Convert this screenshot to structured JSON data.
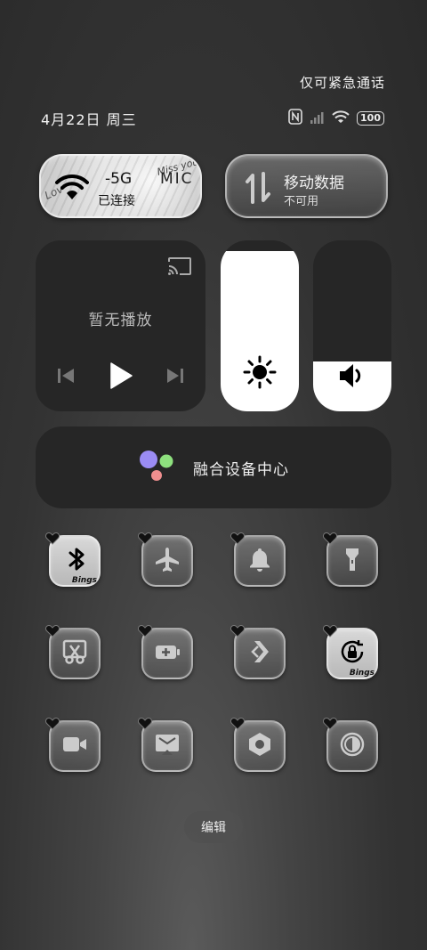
{
  "status": {
    "emergency": "仅可紧急通话",
    "date": "4月22日 周三",
    "battery": "100"
  },
  "wifi": {
    "ssid": "-5G",
    "extra": "MIC",
    "state": "已连接",
    "deco_left": "Lov",
    "deco_right": "Miss you"
  },
  "mobile_data": {
    "title": "移动数据",
    "state": "不可用"
  },
  "media": {
    "empty_label": "暂无播放"
  },
  "brightness": {
    "level_percent": 94
  },
  "volume": {
    "level_percent": 29
  },
  "fusion": {
    "label": "融合设备中心",
    "dot_colors": [
      "#9b8cf4",
      "#8ee07e",
      "#f08f8f"
    ]
  },
  "toggles": [
    {
      "name": "bluetooth",
      "icon": "bluetooth-icon",
      "active": true,
      "tag": "Bings"
    },
    {
      "name": "airplane",
      "icon": "airplane-icon",
      "active": false
    },
    {
      "name": "ring",
      "icon": "bell-icon",
      "active": false
    },
    {
      "name": "flashlight",
      "icon": "flashlight-icon",
      "active": false
    },
    {
      "name": "screenshot",
      "icon": "scissors-icon",
      "active": false
    },
    {
      "name": "battery-saver",
      "icon": "battery-plus-icon",
      "active": false
    },
    {
      "name": "transfer",
      "icon": "chevrons-icon",
      "active": false
    },
    {
      "name": "rotation-lock",
      "icon": "rotation-lock-icon",
      "active": true,
      "tag": "Bings"
    },
    {
      "name": "screen-record",
      "icon": "video-camera-icon",
      "active": false
    },
    {
      "name": "screen-cast",
      "icon": "cast-screen-icon",
      "active": false
    },
    {
      "name": "settings",
      "icon": "hexagon-nut-icon",
      "active": false
    },
    {
      "name": "invert-colors",
      "icon": "contrast-icon",
      "active": false
    }
  ],
  "edit_label": "编辑"
}
